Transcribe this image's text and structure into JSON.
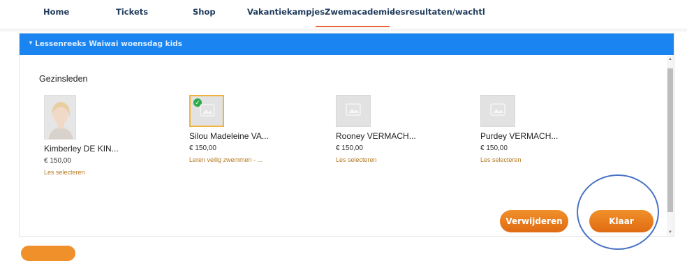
{
  "nav": {
    "tabs": [
      {
        "label": "Home"
      },
      {
        "label": "Tickets"
      },
      {
        "label": "Shop"
      },
      {
        "label": "Vakantiekampjes"
      },
      {
        "label": "Zwemacademie"
      },
      {
        "label": "lesresultaten/wachtl"
      }
    ],
    "active_tab": "Zwemacademie"
  },
  "panel": {
    "title": "Lessenreeks Waiwai woensdag kids",
    "section_title": "Gezinsleden",
    "members": [
      {
        "name": "Kimberley DE KIN...",
        "price": "€ 150,00",
        "link": "Les selecteren",
        "has_photo": true,
        "selected": false
      },
      {
        "name": "Silou Madeleine VA...",
        "price": "€ 150,00",
        "link": "Leren veilig zwemmen - ...",
        "has_photo": false,
        "selected": true
      },
      {
        "name": "Rooney VERMACH...",
        "price": "€ 150,00",
        "link": "Les selecteren",
        "has_photo": false,
        "selected": false
      },
      {
        "name": "Purdey VERMACH...",
        "price": "€ 150,00",
        "link": "Les selecteren",
        "has_photo": false,
        "selected": false
      }
    ]
  },
  "buttons": {
    "remove_label": "Verwijderen",
    "done_label": "Klaar"
  },
  "colors": {
    "header_blue": "#1a84f0",
    "accent_orange": "#e8781f",
    "link_brown": "#b4791f",
    "check_green": "#2eaa4a"
  }
}
